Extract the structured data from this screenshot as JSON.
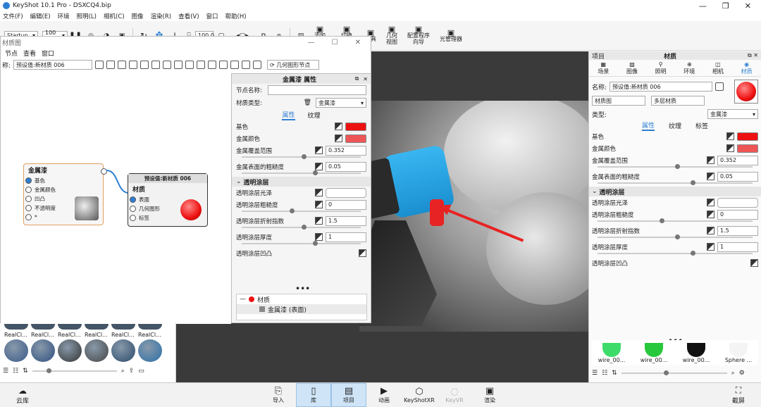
{
  "app": {
    "title": "KeyShot 10.1 Pro  -  DSXCQ4.bip"
  },
  "menubar": [
    "文件(F)",
    "编辑(E)",
    "环境",
    "照明(L)",
    "相机(C)",
    "图像",
    "渲染(R)",
    "查看(V)",
    "窗口",
    "帮助(H)"
  ],
  "toolbar": {
    "startup": "Startup",
    "zoom": "100 %",
    "zoom_value": "100.0",
    "buttons": [
      {
        "label": "添加\n工作室"
      },
      {
        "label": "切换\n工作室"
      },
      {
        "label": "工具"
      },
      {
        "label": "几何\n视图"
      },
      {
        "label": "配置程序\n向导"
      },
      {
        "label": "光管理器"
      }
    ]
  },
  "material_graph": {
    "title": "材质图",
    "menu": [
      "节点",
      "查看",
      "窗口"
    ],
    "name_label": "称:",
    "name_value": "预设值:新材质 006",
    "geometry_node_btn": "几何图形节点",
    "node_metal": {
      "title": "金属漆",
      "ports": [
        "基色",
        "金属颜色",
        "凹凸",
        "不透明度",
        "*"
      ]
    },
    "node_material": {
      "header": "预设值:新材质 006",
      "title": "材质",
      "ports": [
        "表面",
        "几何图形",
        "标签"
      ]
    }
  },
  "props_panel": {
    "title": "金属漆 属性",
    "node_name_label": "节点名称:",
    "material_type_label": "材质类型:",
    "material_type_value": "金属漆",
    "tabs": [
      "属性",
      "纹理"
    ],
    "props": [
      {
        "label": "基色",
        "color": "#ee1111"
      },
      {
        "label": "金属颜色",
        "color": "#ee5555"
      },
      {
        "label": "金属覆盖范围",
        "value": "0.352"
      },
      {
        "label": "金属表面的粗糙度",
        "value": "0.05"
      }
    ],
    "clear_coat_section": "透明涂层",
    "clear_props": [
      {
        "label": "透明涂层光泽",
        "value": ""
      },
      {
        "label": "透明涂层粗糙度",
        "value": "0"
      },
      {
        "label": "透明涂层折射指数",
        "value": "1.5"
      },
      {
        "label": "透明涂层厚度",
        "value": "1"
      },
      {
        "label": "透明涂层凹凸",
        "value": ""
      }
    ],
    "tree": {
      "root": "材质",
      "child": "金属漆 (表面)"
    }
  },
  "library": {
    "labels": [
      "RealCl...",
      "RealCl...",
      "RealCl...",
      "RealCl...",
      "RealCl...",
      "RealCl..."
    ]
  },
  "right_panel": {
    "header_left": "项目",
    "header_center": "材质",
    "tabs": [
      "场景",
      "图像",
      "照明",
      "环境",
      "相机",
      "材质"
    ],
    "name_label": "名称:",
    "name_value": "预设值:新材质 006",
    "graph_btn": "材质图",
    "multi_btn": "多层材质",
    "type_label": "类型:",
    "type_value": "金属漆",
    "subtabs": [
      "属性",
      "纹理",
      "标签"
    ],
    "props": [
      {
        "label": "基色",
        "color": "#ee1111"
      },
      {
        "label": "金属颜色",
        "color": "#ee5555"
      },
      {
        "label": "金属覆盖范围",
        "value": "0.352"
      },
      {
        "label": "金属表面的粗糙度",
        "value": "0.05"
      }
    ],
    "clear_coat_section": "透明涂层",
    "clear_props": [
      {
        "label": "透明涂层光泽",
        "value": ""
      },
      {
        "label": "透明涂层粗糙度",
        "value": "0"
      },
      {
        "label": "透明涂层折射指数",
        "value": "1.5"
      },
      {
        "label": "透明涂层厚度",
        "value": "1"
      },
      {
        "label": "透明涂层凹凸",
        "value": ""
      }
    ],
    "swatches": [
      {
        "label": "wire_00...",
        "color": "#3ddc6a"
      },
      {
        "label": "wire_00...",
        "color": "#28c83c"
      },
      {
        "label": "wire_00...",
        "color": "#111111"
      },
      {
        "label": "Sphere ...",
        "color": "#f4f4f4"
      }
    ]
  },
  "bottom_bar": {
    "left": "云库",
    "items": [
      "导入",
      "库",
      "项目",
      "动画",
      "KeyShotXR",
      "KeyVR",
      "渲染"
    ],
    "right": "截屏"
  },
  "colors": {
    "accent": "#2d7fd3",
    "red": "#ee1111",
    "cyan": "#1aa9e8"
  }
}
